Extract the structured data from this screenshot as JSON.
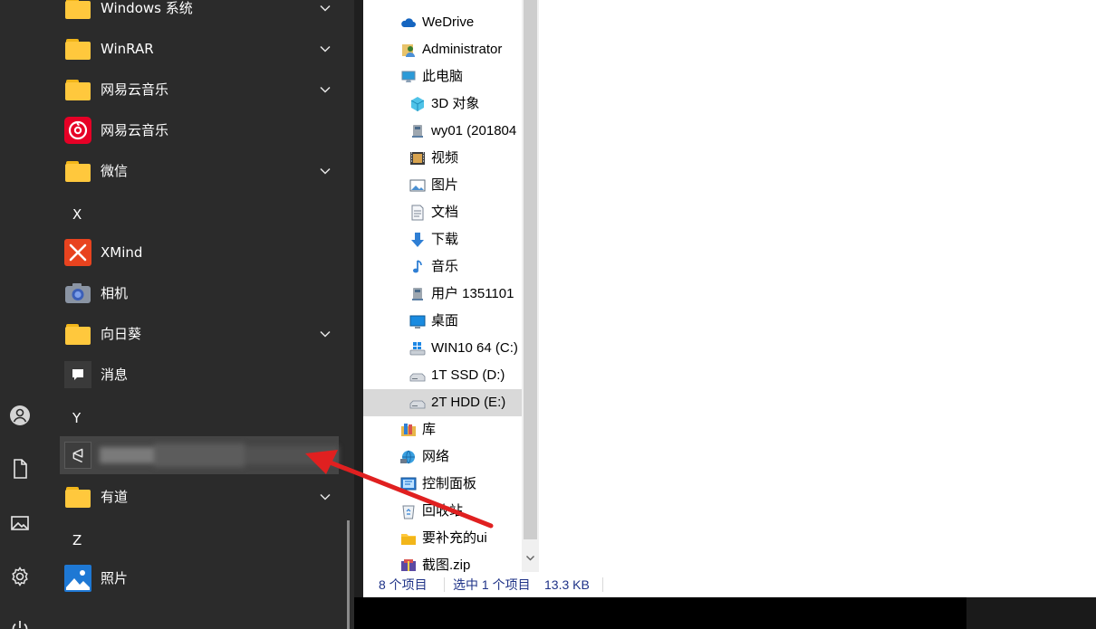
{
  "start_menu": {
    "rail": [
      {
        "icon": "user-icon"
      },
      {
        "icon": "document-icon"
      },
      {
        "icon": "pictures-icon"
      },
      {
        "icon": "settings-icon"
      },
      {
        "icon": "power-icon"
      }
    ],
    "items": [
      {
        "label": "Windows 系统",
        "icon": "folder-icon",
        "expandable": true
      },
      {
        "label": "WinRAR",
        "icon": "folder-icon",
        "expandable": true
      },
      {
        "label": "网易云音乐",
        "icon": "folder-icon",
        "expandable": true
      },
      {
        "label": "网易云音乐",
        "icon": "netease-music-icon",
        "expandable": false
      },
      {
        "label": "微信",
        "icon": "folder-icon",
        "expandable": true
      },
      {
        "letter": "X"
      },
      {
        "label": "XMind",
        "icon": "xmind-icon",
        "expandable": false
      },
      {
        "label": "相机",
        "icon": "camera-icon",
        "expandable": false
      },
      {
        "label": "向日葵",
        "icon": "folder-icon",
        "expandable": true
      },
      {
        "label": "消息",
        "icon": "messaging-icon",
        "expandable": false
      },
      {
        "letter": "Y"
      },
      {
        "label": "",
        "icon": "unity-icon",
        "expandable": false,
        "blurred": true
      },
      {
        "label": "有道",
        "icon": "folder-icon",
        "expandable": true
      },
      {
        "letter": "Z"
      },
      {
        "label": "照片",
        "icon": "photos-icon",
        "expandable": false
      }
    ]
  },
  "explorer": {
    "nav": [
      {
        "label": "WeDrive",
        "icon": "cloud-icon",
        "level": 1
      },
      {
        "label": "Administrator",
        "icon": "user-folder-icon",
        "level": 1
      },
      {
        "label": "此电脑",
        "icon": "this-pc-icon",
        "level": 1
      },
      {
        "label": "3D 对象",
        "icon": "3d-objects-icon",
        "level": 2
      },
      {
        "label": "wy01 (201804",
        "icon": "network-drive-icon",
        "level": 2
      },
      {
        "label": "视频",
        "icon": "videos-icon",
        "level": 2
      },
      {
        "label": "图片",
        "icon": "pictures-icon",
        "level": 2
      },
      {
        "label": "文档",
        "icon": "documents-icon",
        "level": 2
      },
      {
        "label": "下载",
        "icon": "downloads-icon",
        "level": 2
      },
      {
        "label": "音乐",
        "icon": "music-icon",
        "level": 2
      },
      {
        "label": "用户 1351101",
        "icon": "network-drive-icon",
        "level": 2
      },
      {
        "label": "桌面",
        "icon": "desktop-icon",
        "level": 2
      },
      {
        "label": "WIN10 64 (C:)",
        "icon": "windows-drive-icon",
        "level": 2
      },
      {
        "label": "1T SSD (D:)",
        "icon": "drive-icon",
        "level": 2
      },
      {
        "label": "2T HDD (E:)",
        "icon": "drive-icon",
        "level": 2,
        "selected": true
      },
      {
        "label": "库",
        "icon": "libraries-icon",
        "level": 1
      },
      {
        "label": "网络",
        "icon": "network-icon",
        "level": 1
      },
      {
        "label": "控制面板",
        "icon": "control-panel-icon",
        "level": 1
      },
      {
        "label": "回收站",
        "icon": "recycle-bin-icon",
        "level": 1
      },
      {
        "label": "要补充的ui",
        "icon": "folder-icon",
        "level": 1
      },
      {
        "label": "截图.zip",
        "icon": "zip-icon",
        "level": 1
      }
    ],
    "status": {
      "item_count": "8 个项目",
      "selection": "选中 1 个项目",
      "size": "13.3 KB"
    }
  },
  "colors": {
    "start_bg": "#2b2b2b",
    "folder": "#ffc83d",
    "selected_nav": "#d9d9d9",
    "status_text": "#1e3287",
    "annotation_arrow": "#e02020"
  }
}
